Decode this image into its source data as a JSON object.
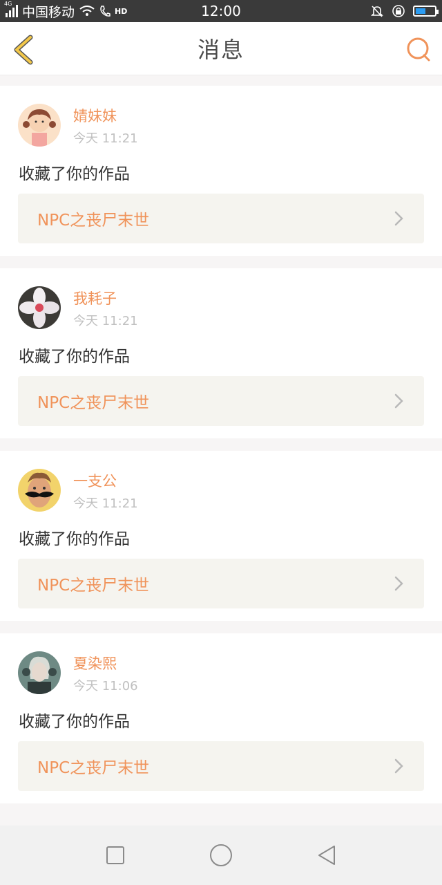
{
  "status_bar": {
    "network_tag": "4G",
    "carrier": "中国移动",
    "hd_label": "HD",
    "time": "12:00",
    "battery_level": 0.55
  },
  "header": {
    "title": "消息",
    "back_icon": "chevron-left-icon",
    "search_icon": "search-icon"
  },
  "colors": {
    "accent": "#f0935a",
    "back": "#f3c84a",
    "text": "#333333",
    "muted": "#c0c0c0",
    "work_bg": "#f5f4ef"
  },
  "messages": [
    {
      "username": "婧妹妹",
      "time": "今天 11:21",
      "action": "收藏了你的作品",
      "work_title": "NPC之丧尸末世"
    },
    {
      "username": "我耗子",
      "time": "今天 11:21",
      "action": "收藏了你的作品",
      "work_title": "NPC之丧尸末世"
    },
    {
      "username": "一支公",
      "time": "今天 11:21",
      "action": "收藏了你的作品",
      "work_title": "NPC之丧尸末世"
    },
    {
      "username": "夏染熙",
      "time": "今天 11:06",
      "action": "收藏了你的作品",
      "work_title": "NPC之丧尸末世"
    }
  ],
  "system_nav": [
    "square-icon",
    "circle-icon",
    "triangle-back-icon"
  ]
}
